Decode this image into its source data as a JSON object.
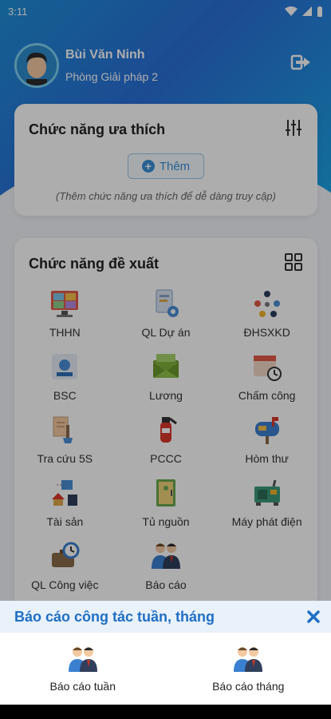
{
  "status_bar": {
    "time": "3:11"
  },
  "profile": {
    "name": "Bùi Văn Ninh",
    "department": "Phòng Giải pháp 2"
  },
  "favorites": {
    "title": "Chức năng ưa thích",
    "add_label": "Thêm",
    "hint": "(Thêm chức năng ưa thích để dễ dàng truy cập)"
  },
  "suggested": {
    "title": "Chức năng đề xuất",
    "items": [
      {
        "label": "THHN",
        "icon": "video-meeting-icon"
      },
      {
        "label": "QL Dự án",
        "icon": "project-docs-icon"
      },
      {
        "label": "ĐHSXKD",
        "icon": "network-icon"
      },
      {
        "label": "BSC",
        "icon": "bsc-chart-icon"
      },
      {
        "label": "Lương",
        "icon": "money-envelope-icon"
      },
      {
        "label": "Chấm công",
        "icon": "calendar-clock-icon"
      },
      {
        "label": "Tra cứu 5S",
        "icon": "cleaning-docs-icon"
      },
      {
        "label": "PCCC",
        "icon": "fire-extinguisher-icon"
      },
      {
        "label": "Hòm thư",
        "icon": "mailbox-icon"
      },
      {
        "label": "Tài sản",
        "icon": "assets-icon"
      },
      {
        "label": "Tủ nguồn",
        "icon": "power-cabinet-icon"
      },
      {
        "label": "Máy phát điện",
        "icon": "generator-icon"
      },
      {
        "label": "QL Công việc",
        "icon": "work-clock-icon"
      },
      {
        "label": "Báo cáo",
        "icon": "people-report-icon"
      }
    ]
  },
  "sheet": {
    "title": "Báo cáo công tác tuần, tháng",
    "options": [
      {
        "label": "Báo cáo tuần"
      },
      {
        "label": "Báo cáo tháng"
      }
    ]
  }
}
